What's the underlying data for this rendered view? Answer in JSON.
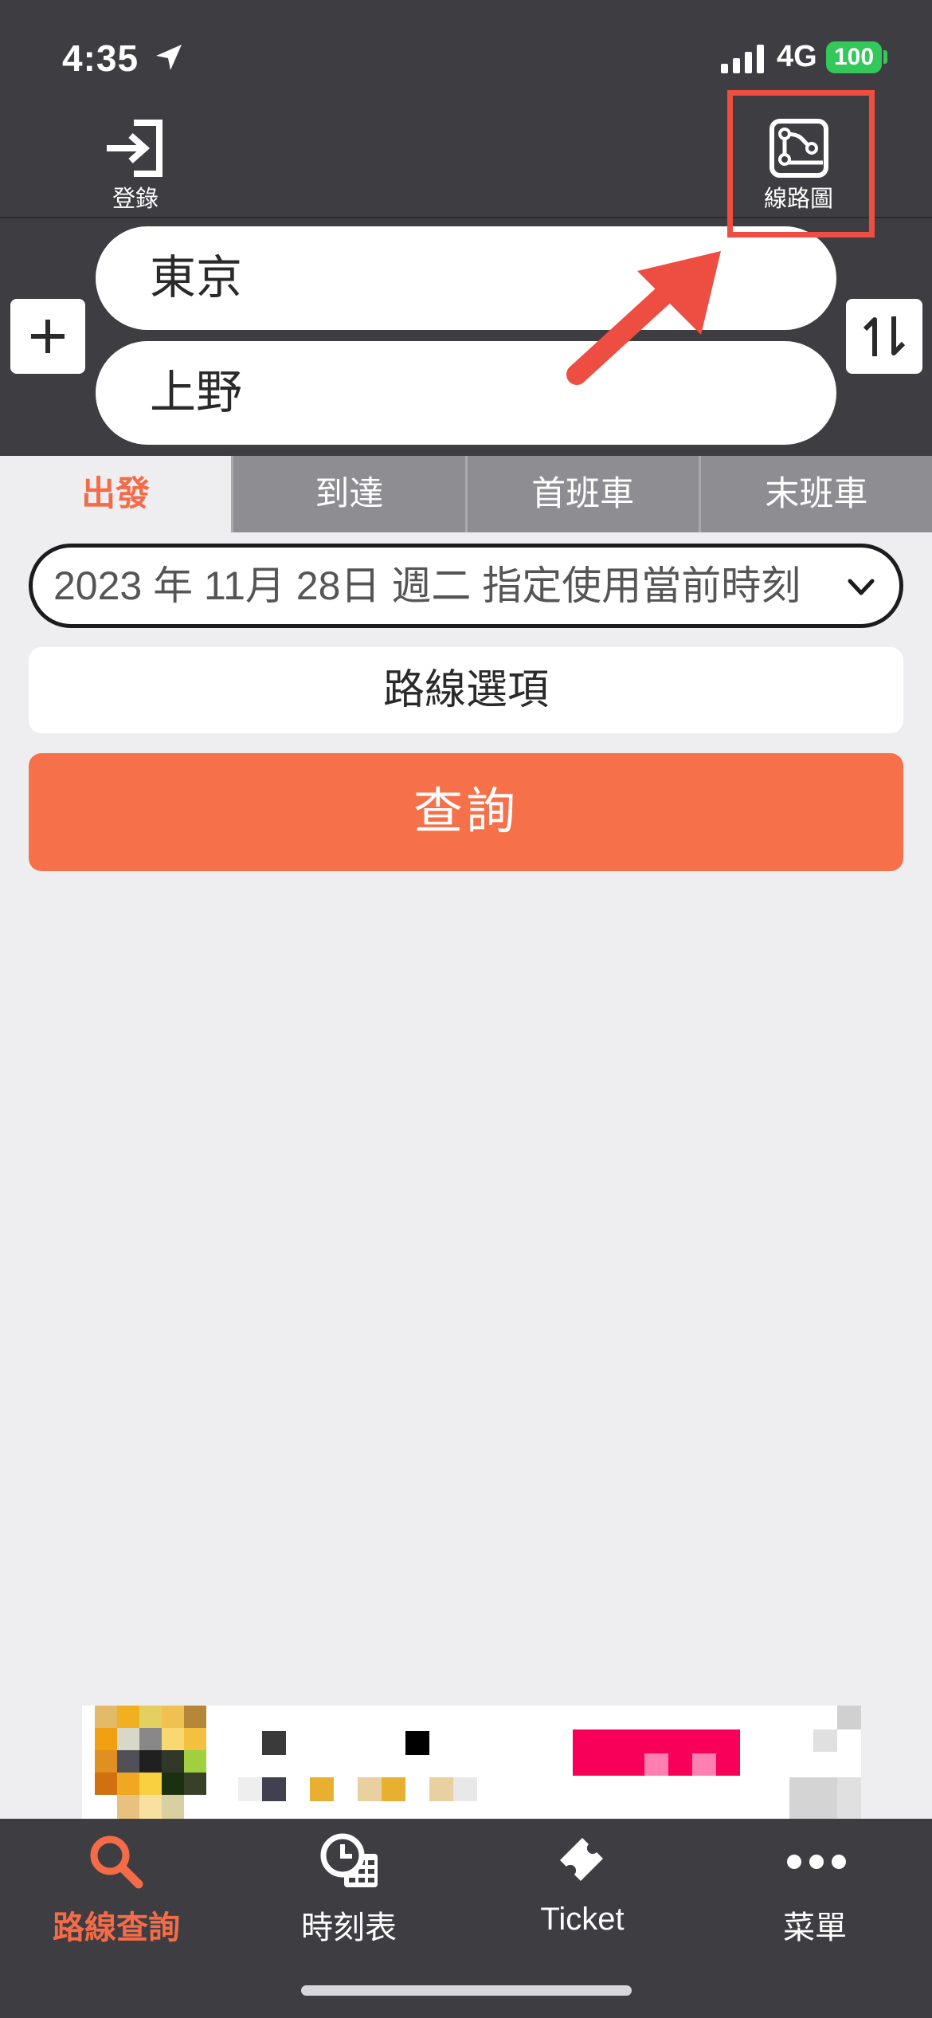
{
  "status_bar": {
    "time": "4:35",
    "network": "4G",
    "battery": "100"
  },
  "header": {
    "login_label": "登錄",
    "route_map_label": "線路圖"
  },
  "stations": {
    "from": "東京",
    "to": "上野"
  },
  "tabs": [
    {
      "label": "出發",
      "active": true
    },
    {
      "label": "到達",
      "active": false
    },
    {
      "label": "首班車",
      "active": false
    },
    {
      "label": "末班車",
      "active": false
    }
  ],
  "date_select": {
    "value": "2023 年 11月 28日 週二 指定使用當前時刻"
  },
  "route_options_label": "路線選項",
  "search_label": "查詢",
  "bottom_nav": [
    {
      "label": "路線查詢",
      "icon": "search-icon",
      "active": true
    },
    {
      "label": "時刻表",
      "icon": "timetable-icon",
      "active": false
    },
    {
      "label": "Ticket",
      "icon": "ticket-icon",
      "active": false
    },
    {
      "label": "菜單",
      "icon": "more-icon",
      "active": false
    }
  ],
  "colors": {
    "accent": "#f6714a",
    "header_bg": "#3e3e42",
    "highlight": "#ee4d42",
    "page_bg": "#eeeef0"
  }
}
